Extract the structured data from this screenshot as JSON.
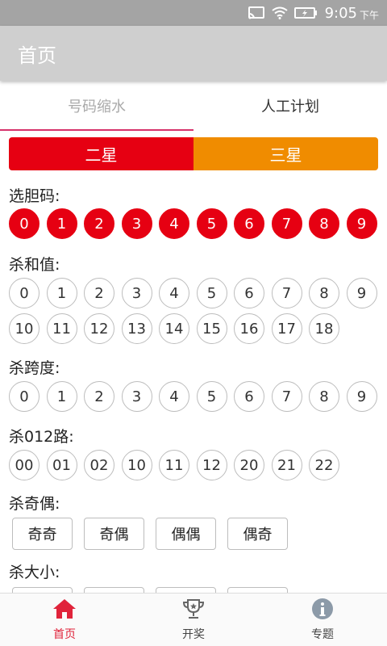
{
  "status_bar": {
    "time": "9:05",
    "ampm": "下午",
    "icons": [
      "cast-icon",
      "wifi-icon",
      "battery-charging-icon"
    ]
  },
  "app_bar": {
    "title": "首页"
  },
  "tabs": [
    {
      "label": "号码缩水",
      "selected": true
    },
    {
      "label": "人工计划",
      "selected": false
    }
  ],
  "segments": [
    {
      "label": "二星",
      "selected": true,
      "color": "#e60012"
    },
    {
      "label": "三星",
      "selected": false,
      "color": "#f08c00"
    }
  ],
  "sections": {
    "dan": {
      "label": "选胆码:",
      "balls": [
        "0",
        "1",
        "2",
        "3",
        "4",
        "5",
        "6",
        "7",
        "8",
        "9"
      ]
    },
    "sum": {
      "label": "杀和值:",
      "row1": [
        "0",
        "1",
        "2",
        "3",
        "4",
        "5",
        "6",
        "7",
        "8",
        "9"
      ],
      "row2": [
        "10",
        "11",
        "12",
        "13",
        "14",
        "15",
        "16",
        "17",
        "18"
      ]
    },
    "span": {
      "label": "杀跨度:",
      "balls": [
        "0",
        "1",
        "2",
        "3",
        "4",
        "5",
        "6",
        "7",
        "8",
        "9"
      ]
    },
    "route": {
      "label": "杀012路:",
      "balls": [
        "00",
        "01",
        "02",
        "10",
        "11",
        "12",
        "20",
        "21",
        "22"
      ]
    },
    "parity": {
      "label": "杀奇偶:",
      "options": [
        "奇奇",
        "奇偶",
        "偶偶",
        "偶奇"
      ]
    },
    "size": {
      "label": "杀大小:"
    }
  },
  "bottom_nav": [
    {
      "label": "首页",
      "icon": "home-icon",
      "active": true
    },
    {
      "label": "开奖",
      "icon": "trophy-icon",
      "active": false
    },
    {
      "label": "专题",
      "icon": "info-icon",
      "active": false
    }
  ],
  "colors": {
    "accent_red": "#e60012",
    "accent_orange": "#f08c00",
    "tab_indicator": "#d6336c"
  }
}
